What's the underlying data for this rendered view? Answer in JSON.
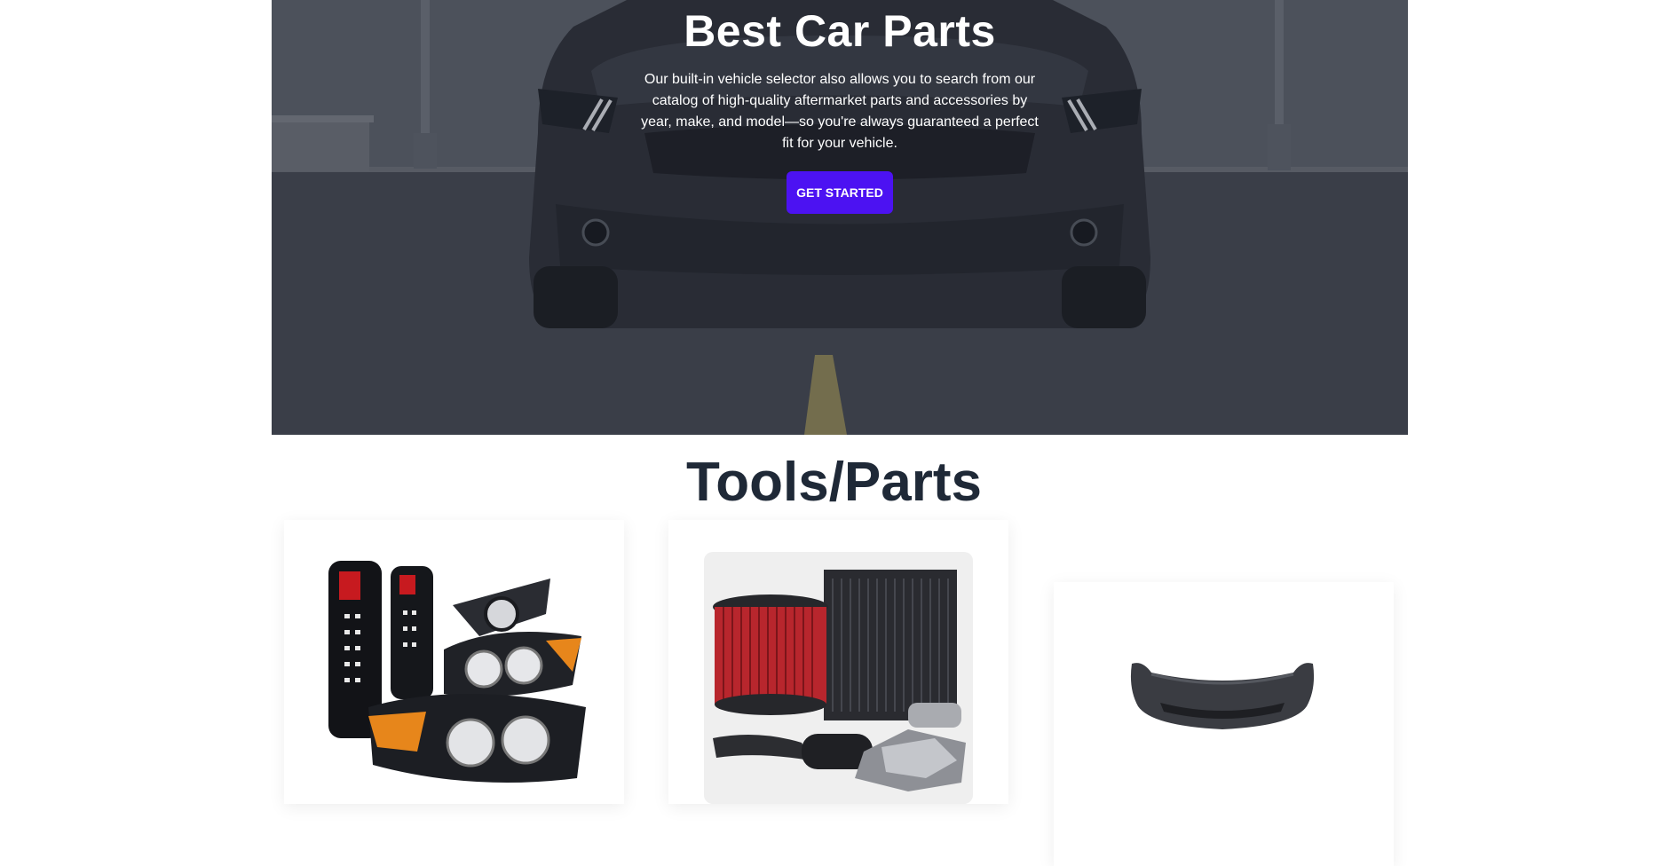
{
  "hero": {
    "title": "Best Car Parts",
    "description": "Our built-in vehicle selector also allows you to search from our catalog of high-quality aftermarket parts and accessories by year, make, and model—so you're always guaranteed a perfect fit for your vehicle.",
    "cta_label": "GET STARTED",
    "cta_color": "#4c12f2"
  },
  "section": {
    "title": "Tools/Parts"
  },
  "cards": [
    {
      "image": "lights-image"
    },
    {
      "image": "performance-parts-image"
    },
    {
      "image": "bumper-image"
    }
  ]
}
